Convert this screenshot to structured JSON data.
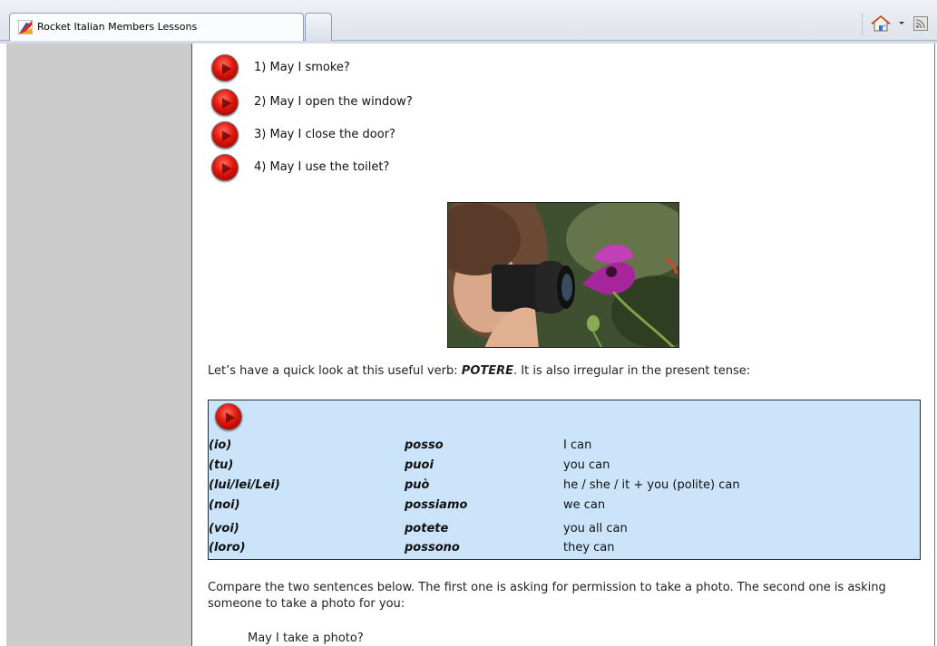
{
  "browser": {
    "tab_title": "Rocket Italian Members Lessons",
    "icons": [
      "rocket-favicon",
      "home-icon",
      "dropdown-arrow-icon",
      "feeds-icon"
    ]
  },
  "questions": [
    "1) May I smoke?",
    "2) May I open the window?",
    "3) May I close the door?",
    "4) May I use the toilet?"
  ],
  "intro": {
    "before": "Let’s have a quick look at this useful verb: ",
    "verb": "POTERE",
    "after": ". It is also irregular in the present tense:"
  },
  "conjugation": [
    {
      "pronoun": "(io)",
      "verb": "posso",
      "translation": "I can"
    },
    {
      "pronoun": "(tu)",
      "verb": "puoi",
      "translation": "you can"
    },
    {
      "pronoun": "(lui/lei/Lei)",
      "verb": "può",
      "translation": "he / she / it + you (polite) can"
    },
    {
      "pronoun": "(noi)",
      "verb": "possiamo",
      "translation": "we can"
    },
    {
      "pronoun": "(voi)",
      "verb": "potete",
      "translation": "you all can"
    },
    {
      "pronoun": "(loro)",
      "verb": "possono",
      "translation": "they can"
    }
  ],
  "compare_text": "Compare the two sentences below. The first one is asking for permission to take a photo. The second one is asking someone to take a photo for you:",
  "example": "May I take a photo?",
  "colors": {
    "table_bg": "#cce4fa",
    "sidebar_bg": "#cccccc",
    "play_red": "#e0160c"
  }
}
